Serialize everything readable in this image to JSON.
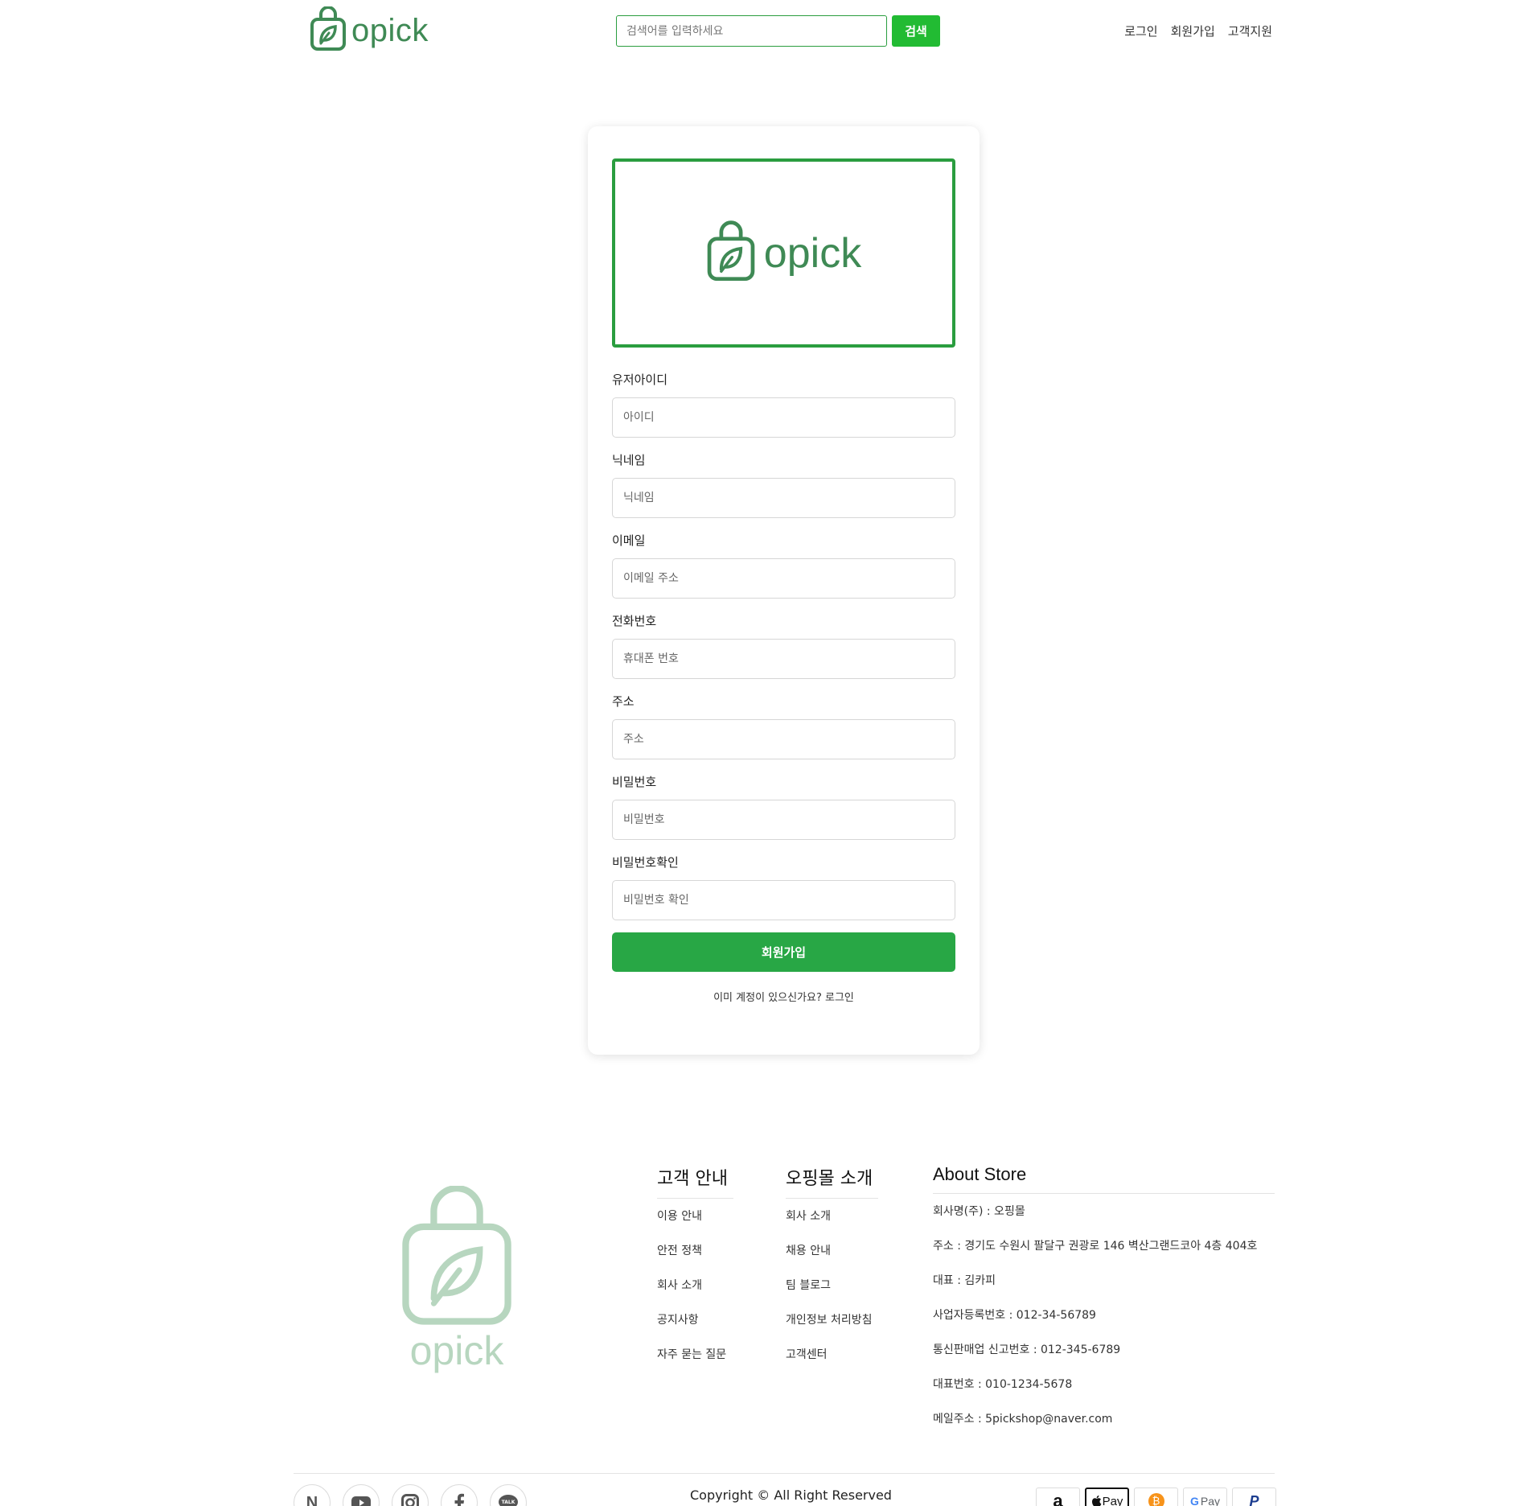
{
  "header": {
    "logo_text": "opick",
    "search": {
      "placeholder": "검색어를 입력하세요",
      "button_label": "검색"
    },
    "nav": [
      "로그인",
      "회원가입",
      "고객지원"
    ]
  },
  "signup": {
    "brand_text": "opick",
    "fields": [
      {
        "label": "유저아이디",
        "placeholder": "아이디"
      },
      {
        "label": "닉네임",
        "placeholder": "닉네임"
      },
      {
        "label": "이메일",
        "placeholder": "이메일 주소"
      },
      {
        "label": "전화번호",
        "placeholder": "휴대폰 번호"
      },
      {
        "label": "주소",
        "placeholder": "주소"
      },
      {
        "label": "비밀번호",
        "placeholder": "비밀번호"
      },
      {
        "label": "비밀번호확인",
        "placeholder": "비밀번호 확인"
      }
    ],
    "submit_label": "회원가입",
    "login_prompt": "이미 계정이 있으신가요?",
    "login_link": "로그인"
  },
  "footer": {
    "logo_text": "opick",
    "columns": [
      {
        "title": "고객 안내",
        "items": [
          "이용 안내",
          "안전 정책",
          "회사 소개",
          "공지사항",
          "자주 묻는 질문"
        ]
      },
      {
        "title": "오핑몰 소개",
        "items": [
          "회사 소개",
          "채용 안내",
          "팀 블로그",
          "개인정보 처리방침",
          "고객센터"
        ]
      },
      {
        "title": "About Store",
        "items": [
          "회사명(주) : 오핑몰",
          "주소 : 경기도 수원시 팔달구 권광로 146 벽산그랜드코아 4층 404호",
          "대표 : 김카피",
          "사업자등록번호 : 012-34-56789",
          "통신판매업 신고번호 : 012-345-6789",
          "대표번호 : 010-1234-5678",
          "메일주소 : 5pickshop@naver.com"
        ]
      }
    ],
    "copyright": "Copyright © All Right Reserved",
    "social_icons": [
      "naver-icon",
      "youtube-icon",
      "instagram-icon",
      "facebook-icon",
      "kakaotalk-icon"
    ],
    "social_labels": {
      "naver": "N",
      "kakao": "TALK"
    },
    "payment_icons": [
      "amazon-pay-icon",
      "apple-pay-icon",
      "bitcoin-icon",
      "google-pay-icon",
      "paypal-icon"
    ],
    "payment_labels": {
      "amazon": "a",
      "apple": "Pay",
      "bitcoin": "₿",
      "google_g": "G",
      "google": "Pay",
      "paypal": "P"
    }
  },
  "colors": {
    "accent": "#28a745",
    "brand": "#3f8a55",
    "search_button": "#22bb33",
    "footer_logo": "#b7d6bf"
  }
}
